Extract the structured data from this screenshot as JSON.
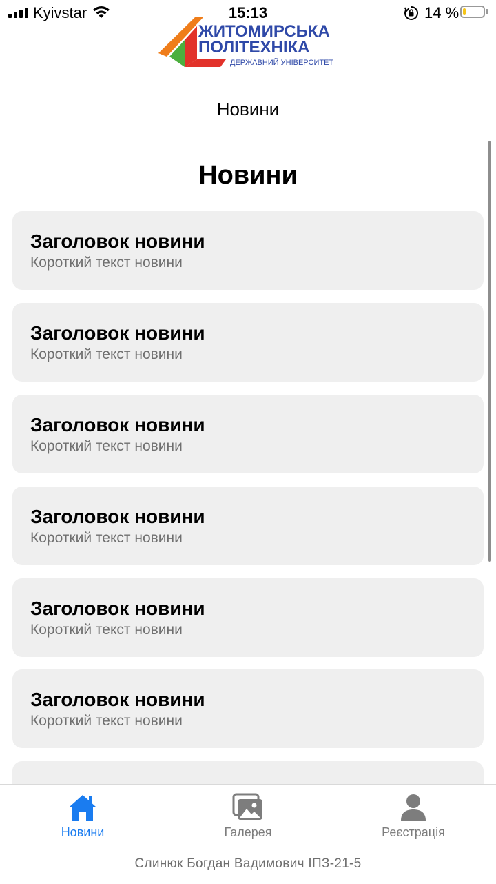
{
  "status_bar": {
    "carrier": "Kyivstar",
    "time": "15:13",
    "battery_percent": "14 %",
    "battery_level": 0.14,
    "icons": [
      "signal-icon",
      "wifi-icon",
      "rotation-lock-icon",
      "battery-icon"
    ]
  },
  "logo": {
    "line1": "ЖИТОМИРСЬКА",
    "line2": "ПОЛІТЕХНІКА",
    "line3": "ДЕРЖАВНИЙ УНІВЕРСИТЕТ"
  },
  "nav": {
    "title": "Новини"
  },
  "page": {
    "heading": "Новини",
    "news": [
      {
        "title": "Заголовок новини",
        "text": "Короткий текст новини"
      },
      {
        "title": "Заголовок новини",
        "text": "Короткий текст новини"
      },
      {
        "title": "Заголовок новини",
        "text": "Короткий текст новини"
      },
      {
        "title": "Заголовок новини",
        "text": "Короткий текст новини"
      },
      {
        "title": "Заголовок новини",
        "text": "Короткий текст новини"
      },
      {
        "title": "Заголовок новини",
        "text": "Короткий текст новини"
      },
      {
        "title": "",
        "text": ""
      }
    ]
  },
  "tabs": [
    {
      "label": "Новини",
      "icon": "home-icon",
      "active": true
    },
    {
      "label": "Галерея",
      "icon": "gallery-icon",
      "active": false
    },
    {
      "label": "Реєстрація",
      "icon": "person-icon",
      "active": false
    }
  ],
  "footer": {
    "credit": "Слинюк Богдан Вадимович ІПЗ-21-5"
  },
  "colors": {
    "accent": "#1a7cf0",
    "tab_inactive": "#7d7d7d",
    "card_bg": "#efefef",
    "logo_blue": "#2f49a8",
    "logo_orange": "#ef7d1a",
    "logo_green": "#4caf3e",
    "logo_red": "#e2322a"
  }
}
